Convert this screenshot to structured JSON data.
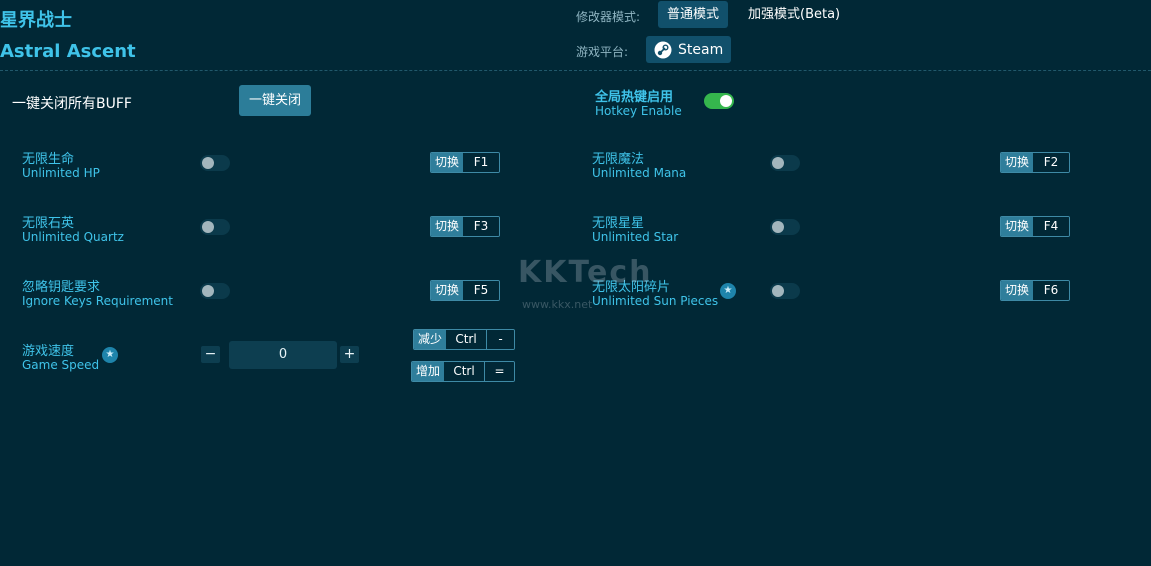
{
  "app": {
    "title_cn": "星界战士",
    "title_en": "Astral Ascent"
  },
  "header": {
    "mode_label": "修改器模式:",
    "mode_normal": "普通模式",
    "mode_enhanced": "加强模式(Beta)",
    "platform_label": "游戏平台:",
    "platform_name": "Steam"
  },
  "global": {
    "close_all_label": "一键关闭所有BUFF",
    "close_all_button": "一键关闭",
    "hotkey_cn": "全局热键启用",
    "hotkey_en": "Hotkey Enable",
    "hotkey_enabled": true
  },
  "options": [
    {
      "cn": "无限生命",
      "en": "Unlimited HP",
      "action": "切换",
      "key": "F1",
      "enabled": false
    },
    {
      "cn": "无限魔法",
      "en": "Unlimited Mana",
      "action": "切换",
      "key": "F2",
      "enabled": false
    },
    {
      "cn": "无限石英",
      "en": "Unlimited Quartz",
      "action": "切换",
      "key": "F3",
      "enabled": false
    },
    {
      "cn": "无限星星",
      "en": "Unlimited Star",
      "action": "切换",
      "key": "F4",
      "enabled": false
    },
    {
      "cn": "忽略钥匙要求",
      "en": "Ignore Keys Requirement",
      "action": "切换",
      "key": "F5",
      "enabled": false
    },
    {
      "cn": "无限太阳碎片",
      "en": "Unlimited Sun Pieces",
      "action": "切换",
      "key": "F6",
      "enabled": false,
      "star": true
    }
  ],
  "speed": {
    "cn": "游戏速度",
    "en": "Game Speed",
    "value": "0",
    "minus": "−",
    "plus": "+",
    "decrease": {
      "action": "减少",
      "mod": "Ctrl",
      "key": "-"
    },
    "increase": {
      "action": "增加",
      "mod": "Ctrl",
      "key": "="
    }
  },
  "watermark": {
    "text": "KKTech",
    "url": "www.kkx.net"
  },
  "colors": {
    "background": "#012836",
    "accent": "#3fc3e9",
    "toggle_on": "#35b64d",
    "button": "#2c7d99"
  }
}
